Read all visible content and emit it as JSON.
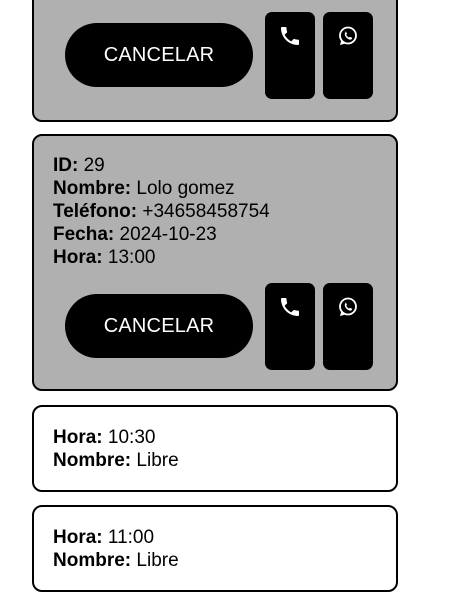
{
  "cards": {
    "top": {
      "cancel_label": "CANCELAR"
    },
    "booked": {
      "id_label": "ID:",
      "id_value": "29",
      "name_label": "Nombre:",
      "name_value": "Lolo gomez",
      "phone_label": "Teléfono:",
      "phone_value": "+34658458754",
      "date_label": "Fecha:",
      "date_value": "2024-10-23",
      "time_label": "Hora:",
      "time_value": "13:00",
      "cancel_label": "CANCELAR"
    },
    "free_1": {
      "time_label": "Hora:",
      "time_value": "10:30",
      "name_label": "Nombre:",
      "name_value": "Libre"
    },
    "free_2": {
      "time_label": "Hora:",
      "time_value": "11:00",
      "name_label": "Nombre:",
      "name_value": "Libre"
    }
  },
  "icons": {
    "call": "phone-icon",
    "chat": "whatsapp-icon"
  },
  "colors": {
    "booked_bg": "#b0b0b0",
    "button_bg": "#000000",
    "button_text": "#ffffff"
  }
}
